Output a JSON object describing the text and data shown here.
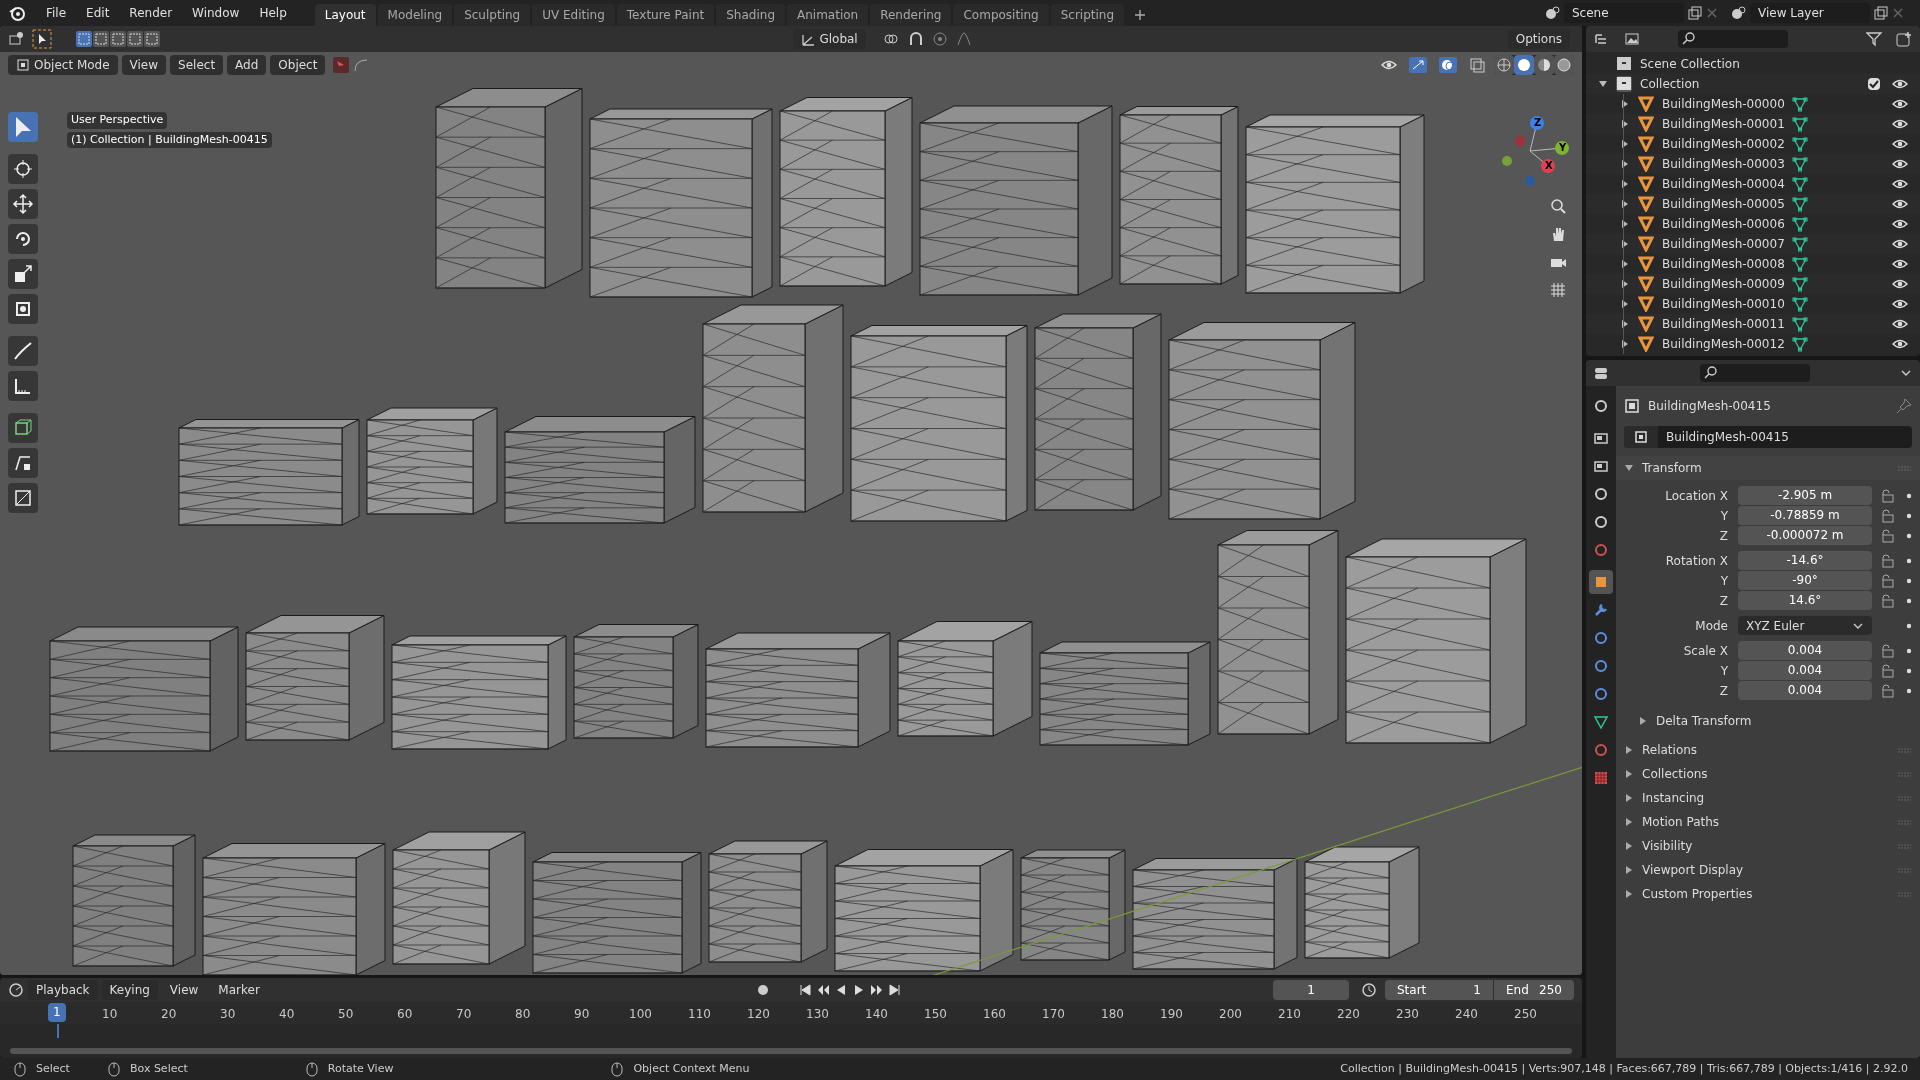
{
  "menu": [
    "File",
    "Edit",
    "Render",
    "Window",
    "Help"
  ],
  "workspaces": [
    {
      "label": "Layout",
      "selected": true
    },
    {
      "label": "Modeling",
      "selected": false
    },
    {
      "label": "Sculpting",
      "selected": false
    },
    {
      "label": "UV Editing",
      "selected": false
    },
    {
      "label": "Texture Paint",
      "selected": false
    },
    {
      "label": "Shading",
      "selected": false
    },
    {
      "label": "Animation",
      "selected": false
    },
    {
      "label": "Rendering",
      "selected": false
    },
    {
      "label": "Compositing",
      "selected": false
    },
    {
      "label": "Scripting",
      "selected": false
    }
  ],
  "scene": "Scene",
  "view_layer": "View Layer",
  "viewport": {
    "mode": "Object Mode",
    "menus": [
      "View",
      "Select",
      "Add",
      "Object"
    ],
    "orientation": "Global",
    "options": "Options",
    "shading": [
      {
        "kind": "wireframe",
        "selected": false
      },
      {
        "kind": "solid",
        "selected": true
      },
      {
        "kind": "material",
        "selected": false
      },
      {
        "kind": "rendered",
        "selected": false
      }
    ],
    "overlay_lines": [
      "User Perspective",
      "(1) Collection | BuildingMesh-00415"
    ],
    "gizmo_axes": [
      "Z",
      "Y",
      "X"
    ],
    "toolbar": [
      {
        "kind": "select",
        "selected": true
      },
      {
        "kind": "cursor",
        "selected": false
      },
      {
        "kind": "move",
        "selected": false
      },
      {
        "kind": "rotate",
        "selected": false
      },
      {
        "kind": "scale",
        "selected": false
      },
      {
        "kind": "transform",
        "selected": false
      },
      {
        "kind": "annotate",
        "selected": false
      },
      {
        "kind": "measure",
        "selected": false
      },
      {
        "kind": "add_cube",
        "selected": false
      },
      {
        "kind": "shear",
        "selected": false
      },
      {
        "kind": "scale_cage",
        "selected": false
      }
    ]
  },
  "outliner": {
    "root": "Scene Collection",
    "collection": {
      "label": "Collection",
      "expanded": true,
      "checked": true,
      "visible": true,
      "children": [
        {
          "label": "BuildingMesh-00000",
          "expanded": false,
          "visible": true
        },
        {
          "label": "BuildingMesh-00001",
          "expanded": false,
          "visible": true
        },
        {
          "label": "BuildingMesh-00002",
          "expanded": false,
          "visible": true
        },
        {
          "label": "BuildingMesh-00003",
          "expanded": false,
          "visible": true
        },
        {
          "label": "BuildingMesh-00004",
          "expanded": false,
          "visible": true
        },
        {
          "label": "BuildingMesh-00005",
          "expanded": false,
          "visible": true
        },
        {
          "label": "BuildingMesh-00006",
          "expanded": false,
          "visible": true
        },
        {
          "label": "BuildingMesh-00007",
          "expanded": false,
          "visible": true
        },
        {
          "label": "BuildingMesh-00008",
          "expanded": false,
          "visible": true
        },
        {
          "label": "BuildingMesh-00009",
          "expanded": false,
          "visible": true
        },
        {
          "label": "BuildingMesh-00010",
          "expanded": false,
          "visible": true
        },
        {
          "label": "BuildingMesh-00011",
          "expanded": false,
          "visible": true
        },
        {
          "label": "BuildingMesh-00012",
          "expanded": false,
          "visible": true
        }
      ]
    }
  },
  "properties": {
    "object_name": "BuildingMesh-00415",
    "data_name": "BuildingMesh-00415",
    "transform": {
      "label": "Transform",
      "expanded": true,
      "groups": [
        [
          {
            "kind": "number",
            "label": "Location X",
            "value": "-2.905 m"
          },
          {
            "kind": "number",
            "label": "Y",
            "value": "-0.78859 m"
          },
          {
            "kind": "number",
            "label": "Z",
            "value": "-0.000072 m"
          }
        ],
        [
          {
            "kind": "number",
            "label": "Rotation X",
            "value": "-14.6°"
          },
          {
            "kind": "number",
            "label": "Y",
            "value": "-90°"
          },
          {
            "kind": "number",
            "label": "Z",
            "value": "14.6°"
          }
        ],
        [
          {
            "kind": "dropdown",
            "label": "Mode",
            "value": "XYZ Euler"
          }
        ],
        [
          {
            "kind": "number",
            "label": "Scale X",
            "value": "0.004"
          },
          {
            "kind": "number",
            "label": "Y",
            "value": "0.004"
          },
          {
            "kind": "number",
            "label": "Z",
            "value": "0.004"
          }
        ]
      ],
      "subpanel": {
        "label": "Delta Transform",
        "expanded": false
      }
    },
    "panels": [
      {
        "label": "Relations",
        "expanded": false
      },
      {
        "label": "Collections",
        "expanded": false
      },
      {
        "label": "Instancing",
        "expanded": false
      },
      {
        "label": "Motion Paths",
        "expanded": false
      },
      {
        "label": "Visibility",
        "expanded": false
      },
      {
        "label": "Viewport Display",
        "expanded": false
      },
      {
        "label": "Custom Properties",
        "expanded": false
      }
    ]
  },
  "timeline": {
    "menus": [
      "Playback",
      "Keying",
      "View",
      "Marker"
    ],
    "current_frame": "1",
    "start_label": "Start",
    "start": "1",
    "end_label": "End",
    "end": "250",
    "playhead": "1",
    "ticks": [
      "10",
      "20",
      "30",
      "40",
      "50",
      "60",
      "70",
      "80",
      "90",
      "100",
      "110",
      "120",
      "130",
      "140",
      "150",
      "160",
      "170",
      "180",
      "190",
      "200",
      "210",
      "220",
      "230",
      "240",
      "250"
    ]
  },
  "status_bar": {
    "hints": [
      "Select",
      "Box Select",
      "Rotate View",
      "Object Context Menu"
    ],
    "stats": "Collection | BuildingMesh-00415 | Verts:907,148 | Faces:667,789 | Tris:667,789 | Objects:1/416 | 2.92.0"
  }
}
